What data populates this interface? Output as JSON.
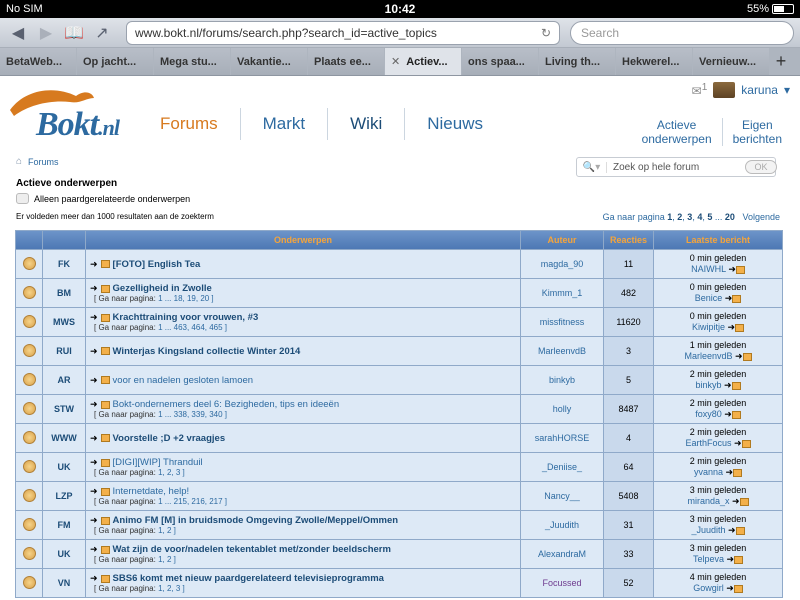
{
  "statusbar": {
    "carrier": "No SIM",
    "time": "10:42",
    "battery": "55%"
  },
  "browser": {
    "url": "www.bokt.nl/forums/search.php?search_id=active_topics",
    "search_placeholder": "Search",
    "tabs": [
      {
        "label": "BetaWeb..."
      },
      {
        "label": "Op jacht..."
      },
      {
        "label": "Mega stu..."
      },
      {
        "label": "Vakantie..."
      },
      {
        "label": "Plaats ee..."
      },
      {
        "label": "Actiev...",
        "active": true
      },
      {
        "label": "ons spaa..."
      },
      {
        "label": "Living th..."
      },
      {
        "label": "Hekwerel..."
      },
      {
        "label": "Vernieuw..."
      }
    ]
  },
  "site": {
    "logo": "Bokt",
    "logo_suffix": ".nl",
    "nav": [
      "Forums",
      "Markt",
      "Wiki",
      "Nieuws"
    ],
    "messages_count": "1",
    "username": "karuna",
    "right_links": [
      {
        "line1": "Actieve",
        "line2": "onderwerpen"
      },
      {
        "line1": "Eigen",
        "line2": "berichten"
      }
    ]
  },
  "breadcrumb": "Forums",
  "forum_search": {
    "placeholder": "Zoek op hele forum",
    "button": "OK"
  },
  "page": {
    "title": "Actieve onderwerpen",
    "checkbox_label": "Alleen paardgerelateerde onderwerpen",
    "result_count": "Er voldeden meer dan 1000 resultaten aan de zoekterm",
    "pagination": {
      "prefix": "Ga naar pagina",
      "pages": [
        "1",
        "2",
        "3",
        "4",
        "5"
      ],
      "ellipsis": "...",
      "last": "20",
      "next": "Volgende"
    }
  },
  "table": {
    "headers": {
      "topics": "Onderwerpen",
      "author": "Auteur",
      "replies": "Reacties",
      "last": "Laatste bericht"
    },
    "pages_prefix": "[ Ga naar pagina:",
    "rows": [
      {
        "tag": "FK",
        "title": "[FOTO] English Tea",
        "pages": "",
        "author": "magda_90",
        "replies": "11",
        "time": "0 min geleden",
        "user": "NAIWHL"
      },
      {
        "tag": "BM",
        "title": "Gezelligheid in Zwolle",
        "pages": "1 ... 18, 19, 20 ]",
        "author": "Kimmm_1",
        "replies": "482",
        "time": "0 min geleden",
        "user": "Benice"
      },
      {
        "tag": "MWS",
        "title": "Krachttraining voor vrouwen, #3",
        "pages": "1 ... 463, 464, 465 ]",
        "author": "missfitness",
        "replies": "11620",
        "time": "0 min geleden",
        "user": "Kiwipitje"
      },
      {
        "tag": "RUI",
        "title": "Winterjas Kingsland collectie Winter 2014",
        "pages": "",
        "author": "MarleenvdB",
        "replies": "3",
        "time": "1 min geleden",
        "user": "MarleenvdB"
      },
      {
        "tag": "AR",
        "title": "voor en nadelen gesloten lamoen",
        "pages": "",
        "author": "binkyb",
        "replies": "5",
        "time": "2 min geleden",
        "user": "binkyb",
        "read": true
      },
      {
        "tag": "STW",
        "title": "Bokt-ondernemers deel 6: Bezigheden, tips en ideeën",
        "pages": "1 ... 338, 339, 340 ]",
        "author": "holly",
        "replies": "8487",
        "time": "2 min geleden",
        "user": "foxy80",
        "read": true
      },
      {
        "tag": "WWW",
        "title": "Voorstelle ;D +2 vraagjes",
        "pages": "",
        "author": "sarahHORSE",
        "replies": "4",
        "time": "2 min geleden",
        "user": "EarthFocus"
      },
      {
        "tag": "UK",
        "title": "[DIGI][WIP] Thranduil",
        "pages": "1, 2, 3 ]",
        "author": "_Deniise_",
        "replies": "64",
        "time": "2 min geleden",
        "user": "yvanna",
        "read": true
      },
      {
        "tag": "LZP",
        "title": "Internetdate, help!",
        "pages": "1 ... 215, 216, 217 ]",
        "author": "Nancy__",
        "replies": "5408",
        "time": "3 min geleden",
        "user": "miranda_x",
        "read": true
      },
      {
        "tag": "FM",
        "title": "Animo FM [M] in bruidsmode Omgeving Zwolle/Meppel/Ommen",
        "pages": "1, 2 ]",
        "author": "_Juudith",
        "replies": "31",
        "time": "3 min geleden",
        "user": "_Juudith"
      },
      {
        "tag": "UK",
        "title": "Wat zijn de voor/nadelen tekentablet met/zonder beeldscherm",
        "pages": "1, 2 ]",
        "author": "AlexandraM",
        "replies": "33",
        "time": "3 min geleden",
        "user": "Telpeva"
      },
      {
        "tag": "VN",
        "title": "SBS6 komt met nieuw paardgerelateerd televisieprogramma",
        "pages": "1, 2, 3 ]",
        "author": "Focussed",
        "author_color": "#6e3b8f",
        "replies": "52",
        "time": "4 min geleden",
        "user": "Gowgirl"
      }
    ]
  }
}
